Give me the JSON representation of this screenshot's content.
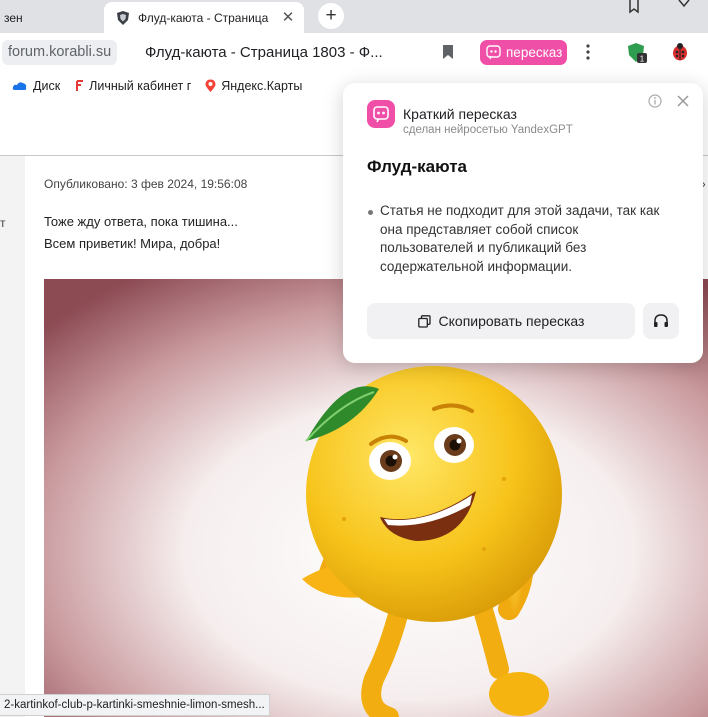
{
  "browser": {
    "prev_tab_title": "зен",
    "active_tab": {
      "title": "Флуд-каюта - Страница",
      "close_icon": "close-icon"
    },
    "new_tab_label": "+",
    "address": {
      "domain": "forum.korabli.su",
      "page_title": "Флуд-каюта - Страница 1803 - Ф..."
    },
    "peresk_button_label": "пересказ",
    "extension_badge": "1"
  },
  "bookmarks": [
    {
      "label": "Диск",
      "icon": "cloud-icon"
    },
    {
      "label": "Личный кабинет г",
      "icon": "f-logo-icon"
    },
    {
      "label": "Яндекс.Карты",
      "icon": "map-pin-icon"
    }
  ],
  "post": {
    "published": "Опубликовано: 3 фев 2024, 19:56:08",
    "line1": "Тоже жду ответа, пока тишина...",
    "line2": "Всем приветик! Мира, добра!",
    "gutter_letter": "т",
    "right_edge": "»"
  },
  "status_url": "2-kartinkof-club-p-kartinki-smeshnie-limon-smesh...",
  "summary_popup": {
    "title": "Краткий пересказ",
    "subtitle": "сделан нейросетью YandexGPT",
    "heading": "Флуд-каюта",
    "bullet": "Статья не подходит для этой задачи, так как она представляет собой список пользователей и публикаций без содержательной информации.",
    "copy_button": "Скопировать пересказ",
    "listen_icon": "headphones-icon"
  },
  "colors": {
    "accent_pink": "#f04fa7",
    "tabstrip_bg": "#dfe1e5",
    "lemon": "#f7c31a"
  }
}
